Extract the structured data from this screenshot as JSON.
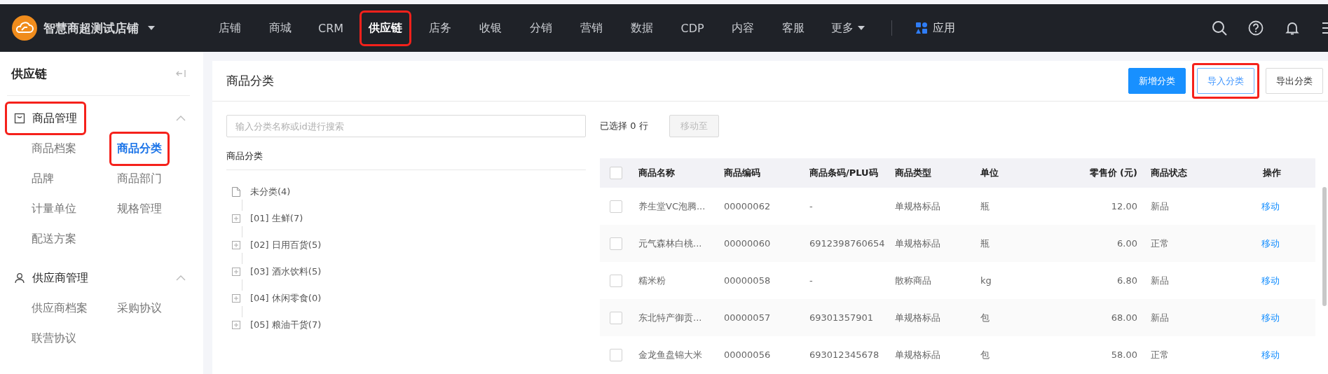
{
  "topbar": {
    "store": "智慧商超测试店铺",
    "nav": [
      {
        "label": "店铺",
        "selected": false,
        "highlighted": false
      },
      {
        "label": "商城",
        "selected": false,
        "highlighted": false
      },
      {
        "label": "CRM",
        "selected": false,
        "highlighted": false
      },
      {
        "label": "供应链",
        "selected": true,
        "highlighted": true
      },
      {
        "label": "店务",
        "selected": false,
        "highlighted": false
      },
      {
        "label": "收银",
        "selected": false,
        "highlighted": false
      },
      {
        "label": "分销",
        "selected": false,
        "highlighted": false
      },
      {
        "label": "营销",
        "selected": false,
        "highlighted": false
      },
      {
        "label": "数据",
        "selected": false,
        "highlighted": false
      },
      {
        "label": "CDP",
        "selected": false,
        "highlighted": false
      },
      {
        "label": "内容",
        "selected": false,
        "highlighted": false
      },
      {
        "label": "客服",
        "selected": false,
        "highlighted": false
      }
    ],
    "more": "更多",
    "apps": "应用"
  },
  "sidebar": {
    "title": "供应链",
    "sections": [
      {
        "label": "商品管理",
        "kind": "goods",
        "expanded": true,
        "highlighted": true,
        "items": [
          {
            "label": "商品档案",
            "selected": false,
            "highlighted": false
          },
          {
            "label": "商品分类",
            "selected": true,
            "highlighted": true
          },
          {
            "label": "品牌",
            "selected": false,
            "highlighted": false
          },
          {
            "label": "商品部门",
            "selected": false,
            "highlighted": false
          },
          {
            "label": "计量单位",
            "selected": false,
            "highlighted": false
          },
          {
            "label": "规格管理",
            "selected": false,
            "highlighted": false
          },
          {
            "label": "配送方案",
            "selected": false,
            "highlighted": false
          }
        ]
      },
      {
        "label": "供应商管理",
        "kind": "supplier",
        "expanded": true,
        "highlighted": false,
        "items": [
          {
            "label": "供应商档案",
            "selected": false,
            "highlighted": false
          },
          {
            "label": "采购协议",
            "selected": false,
            "highlighted": false
          },
          {
            "label": "联营协议",
            "selected": false,
            "highlighted": false
          }
        ]
      }
    ]
  },
  "panel": {
    "title": "商品分类",
    "buttons": [
      {
        "label": "新增分类",
        "kind": "primary",
        "highlighted": false
      },
      {
        "label": "导入分类",
        "kind": "outline",
        "highlighted": true
      },
      {
        "label": "导出分类",
        "kind": "default",
        "highlighted": false
      }
    ],
    "search": {
      "placeholder": "输入分类名称或id进行搜索"
    },
    "tree_title": "商品分类",
    "tree": [
      {
        "label": "未分类(4)",
        "kind": "leaf"
      },
      {
        "label": "[01] 生鲜(7)",
        "kind": "folder",
        "expanded": false
      },
      {
        "label": "[02] 日用百货(5)",
        "kind": "folder",
        "expanded": false
      },
      {
        "label": "[03] 酒水饮料(5)",
        "kind": "folder",
        "expanded": false
      },
      {
        "label": "[04] 休闲零食(0)",
        "kind": "folder",
        "expanded": false
      },
      {
        "label": "[05] 粮油干货(7)",
        "kind": "folder",
        "expanded": false
      }
    ],
    "selection": "已选择 0 行",
    "move_button": {
      "label": "移动至",
      "disabled": true
    },
    "table": {
      "columns": [
        "商品名称",
        "商品编码",
        "商品条码/PLU码",
        "商品类型",
        "单位",
        "零售价 (元)",
        "商品状态",
        "操作"
      ],
      "header_checked": false,
      "rows": [
        {
          "checked": false,
          "cells": [
            "养生堂VC泡腾...",
            "00000062",
            "-",
            "单规格标品",
            "瓶",
            "12.00",
            "新品"
          ],
          "action": "移动"
        },
        {
          "checked": false,
          "cells": [
            "元气森林白桃...",
            "00000060",
            "6912398760654",
            "单规格标品",
            "瓶",
            "6.00",
            "正常"
          ],
          "action": "移动"
        },
        {
          "checked": false,
          "cells": [
            "糯米粉",
            "00000058",
            "-",
            "散称商品",
            "kg",
            "6.80",
            "新品"
          ],
          "action": "移动"
        },
        {
          "checked": false,
          "cells": [
            "东北特产御贡...",
            "00000057",
            "69301357901",
            "单规格标品",
            "包",
            "68.00",
            "新品"
          ],
          "action": "移动"
        },
        {
          "checked": false,
          "cells": [
            "金龙鱼盘锦大米",
            "00000056",
            "693012345678",
            "单规格标品",
            "包",
            "58.00",
            "正常"
          ],
          "action": "移动"
        }
      ]
    }
  }
}
